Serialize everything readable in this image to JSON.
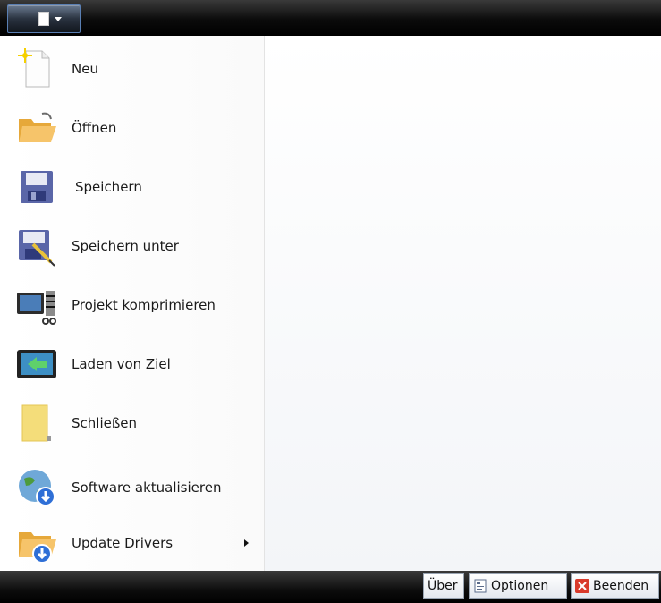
{
  "menu": {
    "items": [
      {
        "label": "Neu",
        "icon": "new-document-icon"
      },
      {
        "label": "Öffnen",
        "icon": "open-folder-icon"
      },
      {
        "label": "Speichern",
        "icon": "save-floppy-icon"
      },
      {
        "label": "Speichern unter",
        "icon": "save-as-icon"
      },
      {
        "label": "Projekt komprimieren",
        "icon": "compress-project-icon"
      },
      {
        "label": "Laden von Ziel",
        "icon": "load-from-target-icon"
      },
      {
        "label": "Schließen",
        "icon": "close-folder-icon"
      },
      {
        "label": "Software aktualisieren",
        "icon": "globe-update-icon"
      },
      {
        "label": "Update Drivers",
        "icon": "folder-update-icon"
      }
    ]
  },
  "bottom": {
    "about_label": "Über",
    "options_label": "Optionen",
    "exit_label": "Beenden"
  },
  "colors": {
    "bar_dark": "#000000",
    "accent_blue": "#2f6fd6",
    "exit_red": "#d93a2b"
  }
}
